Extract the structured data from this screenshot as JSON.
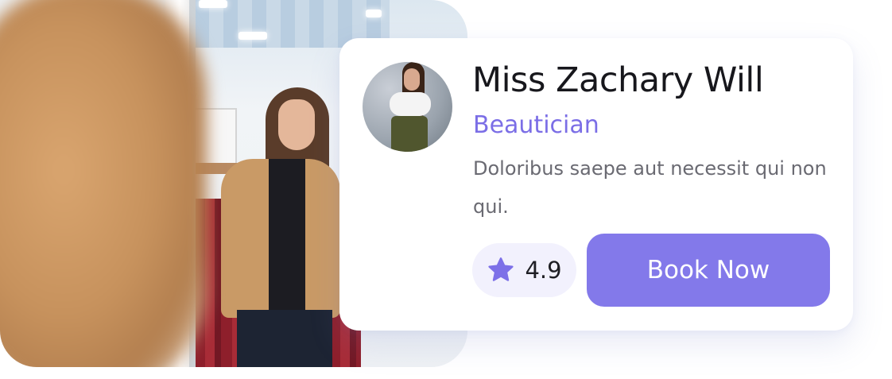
{
  "profile": {
    "name": "Miss Zachary Will",
    "role": "Beautician",
    "description": "Doloribus saepe aut necessit qui non qui."
  },
  "rating": {
    "value": "4.9",
    "icon": "star-icon"
  },
  "actions": {
    "book_label": "Book Now"
  },
  "colors": {
    "accent": "#8379ea",
    "role_text": "#7b6ee6",
    "rating_bg": "#f2f1fd"
  }
}
